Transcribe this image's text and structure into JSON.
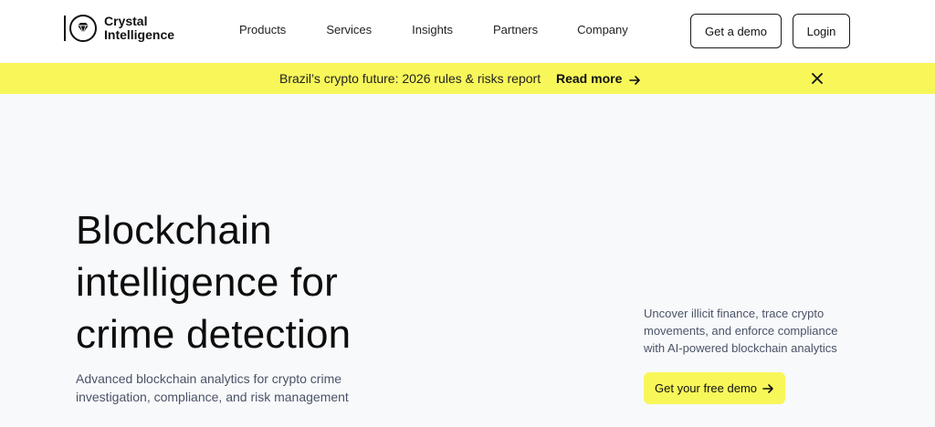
{
  "brand": {
    "line1": "Crystal",
    "line2": "Intelligence"
  },
  "nav": {
    "items": [
      "Products",
      "Services",
      "Insights",
      "Partners",
      "Company"
    ]
  },
  "header": {
    "demo_label": "Get a demo",
    "login_label": "Login"
  },
  "banner": {
    "text": "Brazil’s crypto future: 2026 rules & risks report",
    "link_label": "Read more",
    "color": "#f8f75a"
  },
  "hero": {
    "title_lines": [
      "Blockchain",
      "intelligence for",
      "crime detection"
    ],
    "subtitle_line1": "Advanced blockchain analytics for crypto crime",
    "subtitle_line2": "investigation, compliance, and risk management",
    "side_line1": "Uncover illicit finance, trace crypto",
    "side_line2": "movements, and enforce compliance",
    "side_line3": "with AI-powered blockchain analytics",
    "cta_label": "Get your free demo"
  },
  "icons": [
    "logo-mark-icon",
    "arrow-right-icon",
    "close-icon"
  ]
}
